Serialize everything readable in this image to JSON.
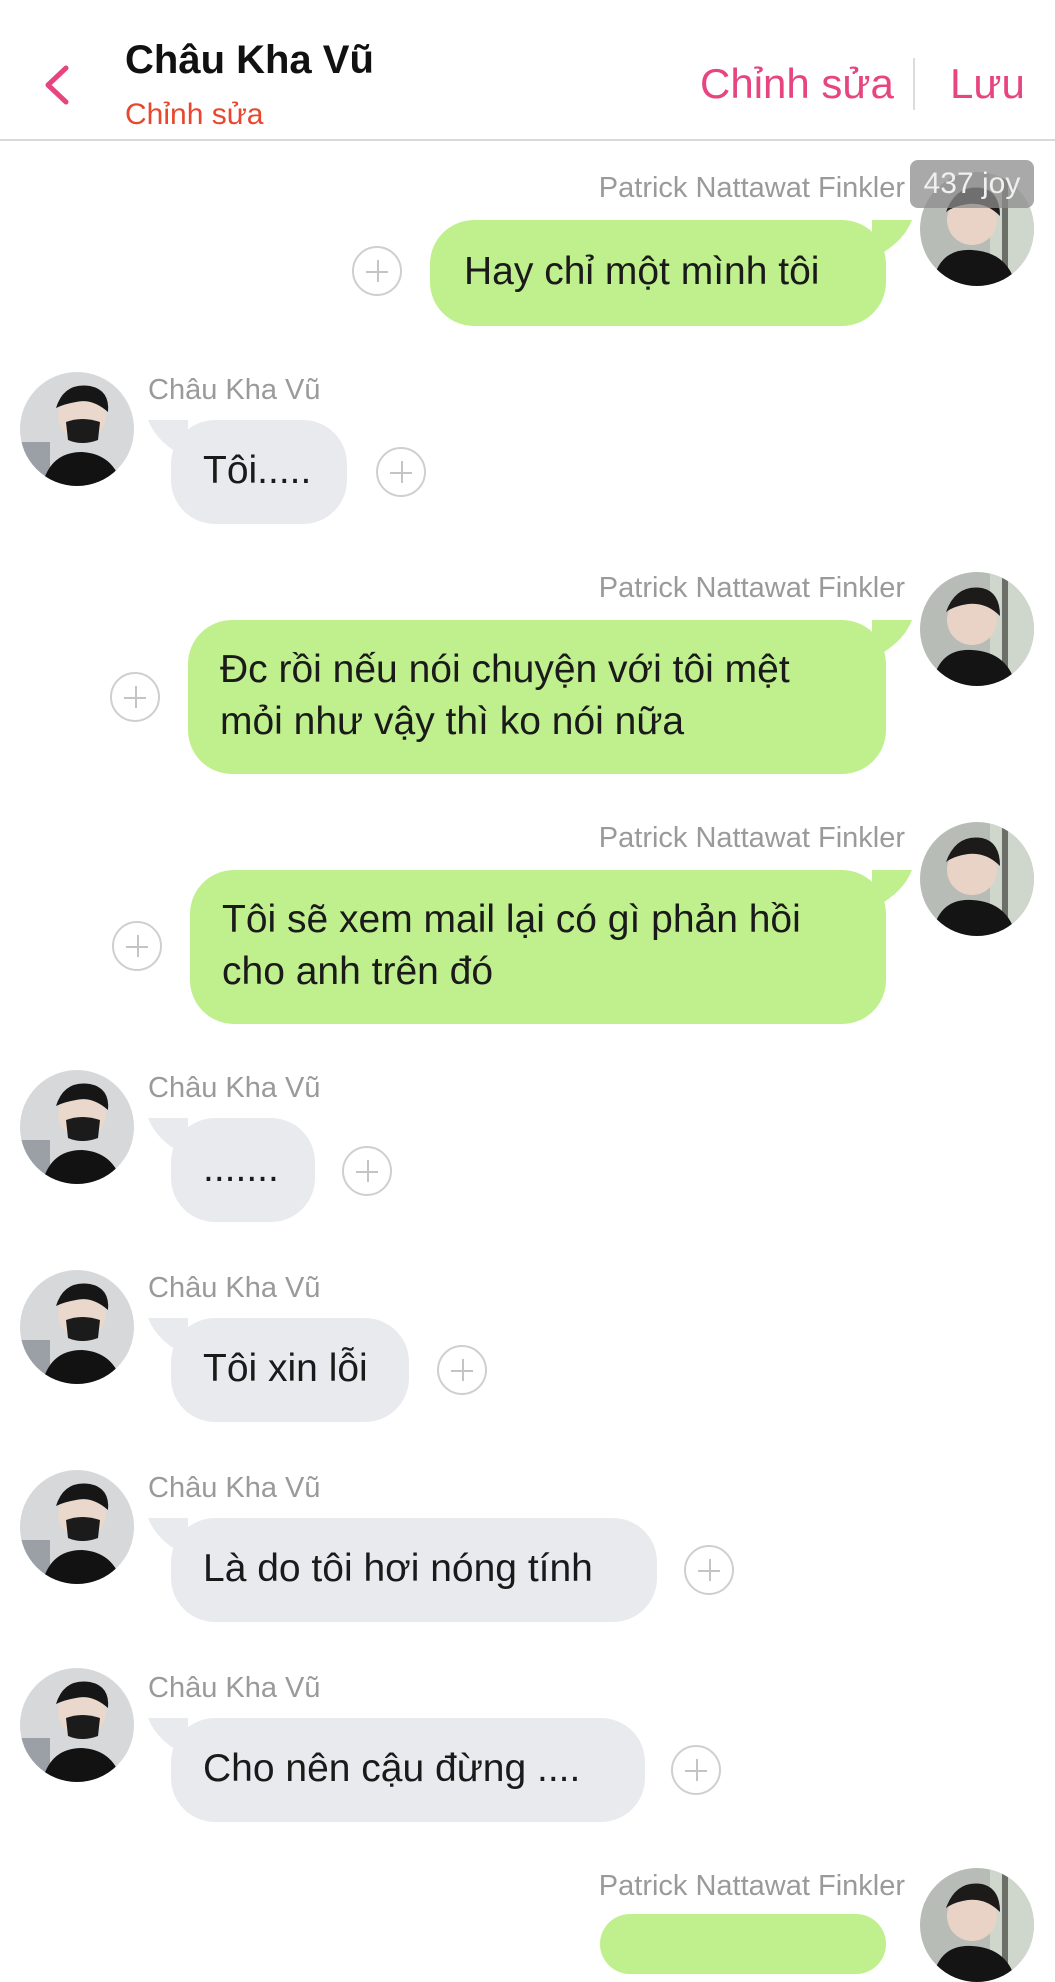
{
  "header": {
    "title": "Châu Kha Vũ",
    "subtitle": "Chỉnh sửa",
    "edit_label": "Chỉnh sửa",
    "save_label": "Lưu"
  },
  "badge": "437 joy",
  "contacts": {
    "outgoing_name": "Patrick Nattawat Finkler",
    "incoming_name": "Châu Kha Vũ"
  },
  "messages": [
    {
      "direction": "out",
      "sender": "Patrick Nattawat Finkler",
      "lines": [
        "Hay chỉ một mình tôi"
      ]
    },
    {
      "direction": "in",
      "sender": "Châu Kha Vũ",
      "lines": [
        "Tôi....."
      ]
    },
    {
      "direction": "out",
      "sender": "Patrick Nattawat Finkler",
      "lines": [
        "Đc rồi nếu nói chuyện với tôi mệt",
        "mỏi như vậy thì ko nói nữa"
      ]
    },
    {
      "direction": "out",
      "sender": "Patrick Nattawat Finkler",
      "lines": [
        "Tôi sẽ xem mail lại có gì phản hồi",
        "cho anh trên đó"
      ]
    },
    {
      "direction": "in",
      "sender": "Châu Kha Vũ",
      "lines": [
        "......."
      ]
    },
    {
      "direction": "in",
      "sender": "Châu Kha Vũ",
      "lines": [
        "Tôi xin lỗi"
      ]
    },
    {
      "direction": "in",
      "sender": "Châu Kha Vũ",
      "lines": [
        "Là do tôi hơi nóng tính"
      ]
    },
    {
      "direction": "in",
      "sender": "Châu Kha Vũ",
      "lines": [
        "Cho nên cậu đừng ...."
      ]
    },
    {
      "direction": "out",
      "sender": "Patrick Nattawat Finkler",
      "lines": [
        ""
      ]
    }
  ],
  "colors": {
    "accent": "#e6457f",
    "subtitle": "#e8472e",
    "outgoing_bubble": "#c0ef8e",
    "incoming_bubble": "#e8eaed"
  }
}
